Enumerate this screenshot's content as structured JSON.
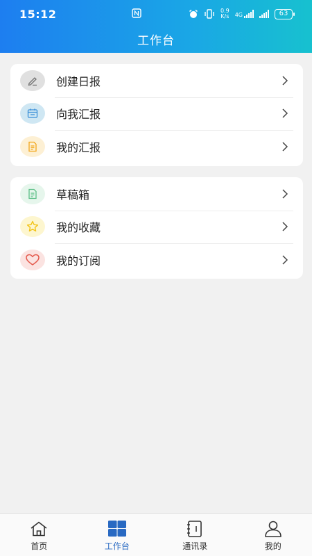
{
  "status_bar": {
    "time": "15:12",
    "speed_value": "0.9",
    "speed_unit": "K/s",
    "network": "4G",
    "battery": "63"
  },
  "header": {
    "title": "工作台"
  },
  "group1": {
    "items": [
      {
        "label": "创建日报",
        "icon": "pen-icon",
        "icon_bg": "#e0e0e0"
      },
      {
        "label": "向我汇报",
        "icon": "calendar-icon",
        "icon_bg": "#cfe7f3"
      },
      {
        "label": "我的汇报",
        "icon": "document-icon",
        "icon_bg": "#fdf0d4"
      }
    ]
  },
  "group2": {
    "items": [
      {
        "label": "草稿箱",
        "icon": "draft-icon",
        "icon_bg": "#e6f6ec"
      },
      {
        "label": "我的收藏",
        "icon": "star-icon",
        "icon_bg": "#fdf6cf"
      },
      {
        "label": "我的订阅",
        "icon": "heart-icon",
        "icon_bg": "#fbe3e1"
      }
    ]
  },
  "tabbar": {
    "tabs": [
      {
        "label": "首页",
        "icon": "home-icon"
      },
      {
        "label": "工作台",
        "icon": "grid-icon",
        "active": true
      },
      {
        "label": "通讯录",
        "icon": "contacts-book-icon"
      },
      {
        "label": "我的",
        "icon": "user-icon"
      }
    ]
  },
  "colors": {
    "header_start": "#1d7ef0",
    "header_end": "#17c1cf",
    "active_tab": "#2869c2",
    "background": "#f1f1f1"
  }
}
